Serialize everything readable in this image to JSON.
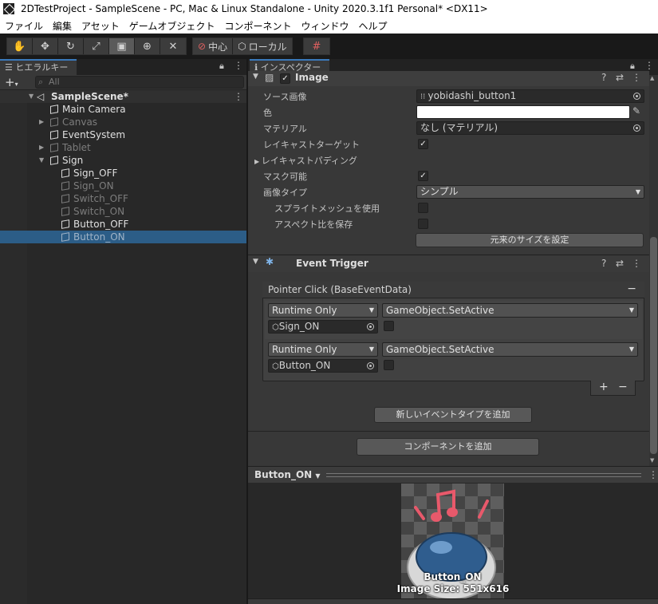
{
  "window": {
    "title": "2DTestProject - SampleScene - PC, Mac & Linux Standalone - Unity 2020.3.1f1 Personal* <DX11>"
  },
  "menu": [
    "ファイル",
    "編集",
    "アセット",
    "ゲームオブジェクト",
    "コンポーネント",
    "ウィンドウ",
    "ヘルプ"
  ],
  "toolbar": {
    "pivot_label": "中心",
    "space_label": "ローカル"
  },
  "hierarchy": {
    "tab_label": "ヒエラルキー",
    "search_placeholder": "All",
    "scene": "SampleScene*",
    "items": [
      {
        "label": "Main Camera"
      },
      {
        "label": "Canvas"
      },
      {
        "label": "EventSystem"
      },
      {
        "label": "Tablet"
      },
      {
        "label": "Sign"
      },
      {
        "label": "Sign_OFF"
      },
      {
        "label": "Sign_ON"
      },
      {
        "label": "Switch_OFF"
      },
      {
        "label": "Switch_ON"
      },
      {
        "label": "Button_OFF"
      },
      {
        "label": "Button_ON"
      }
    ]
  },
  "inspector": {
    "tab_label": "インスペクター",
    "image": {
      "title": "Image",
      "source_label": "ソース画像",
      "source_value": "yobidashi_button1",
      "color_label": "色",
      "material_label": "マテリアル",
      "material_value": "なし (マテリアル)",
      "raycast_label": "レイキャストターゲット",
      "padding_label": "レイキャストパディング",
      "maskable_label": "マスク可能",
      "type_label": "画像タイプ",
      "type_value": "シンプル",
      "sprite_mesh_label": "スプライトメッシュを使用",
      "preserve_label": "アスペクト比を保存",
      "native_size_button": "元来のサイズを設定"
    },
    "event_trigger": {
      "title": "Event Trigger",
      "entry_header": "Pointer Click (BaseEventData)",
      "minus": "−",
      "listeners": [
        {
          "runtime": "Runtime Only",
          "function": "GameObject.SetActive",
          "target": "Sign_ON"
        },
        {
          "runtime": "Runtime Only",
          "function": "GameObject.SetActive",
          "target": "Button_ON"
        }
      ],
      "plus": "+",
      "minus2": "−",
      "add_event_button": "新しいイベントタイプを追加"
    },
    "add_component_button": "コンポーネントを追加"
  },
  "preview": {
    "title": "Button_ON",
    "name": "Button_ON",
    "size": "Image Size: 551x616"
  }
}
